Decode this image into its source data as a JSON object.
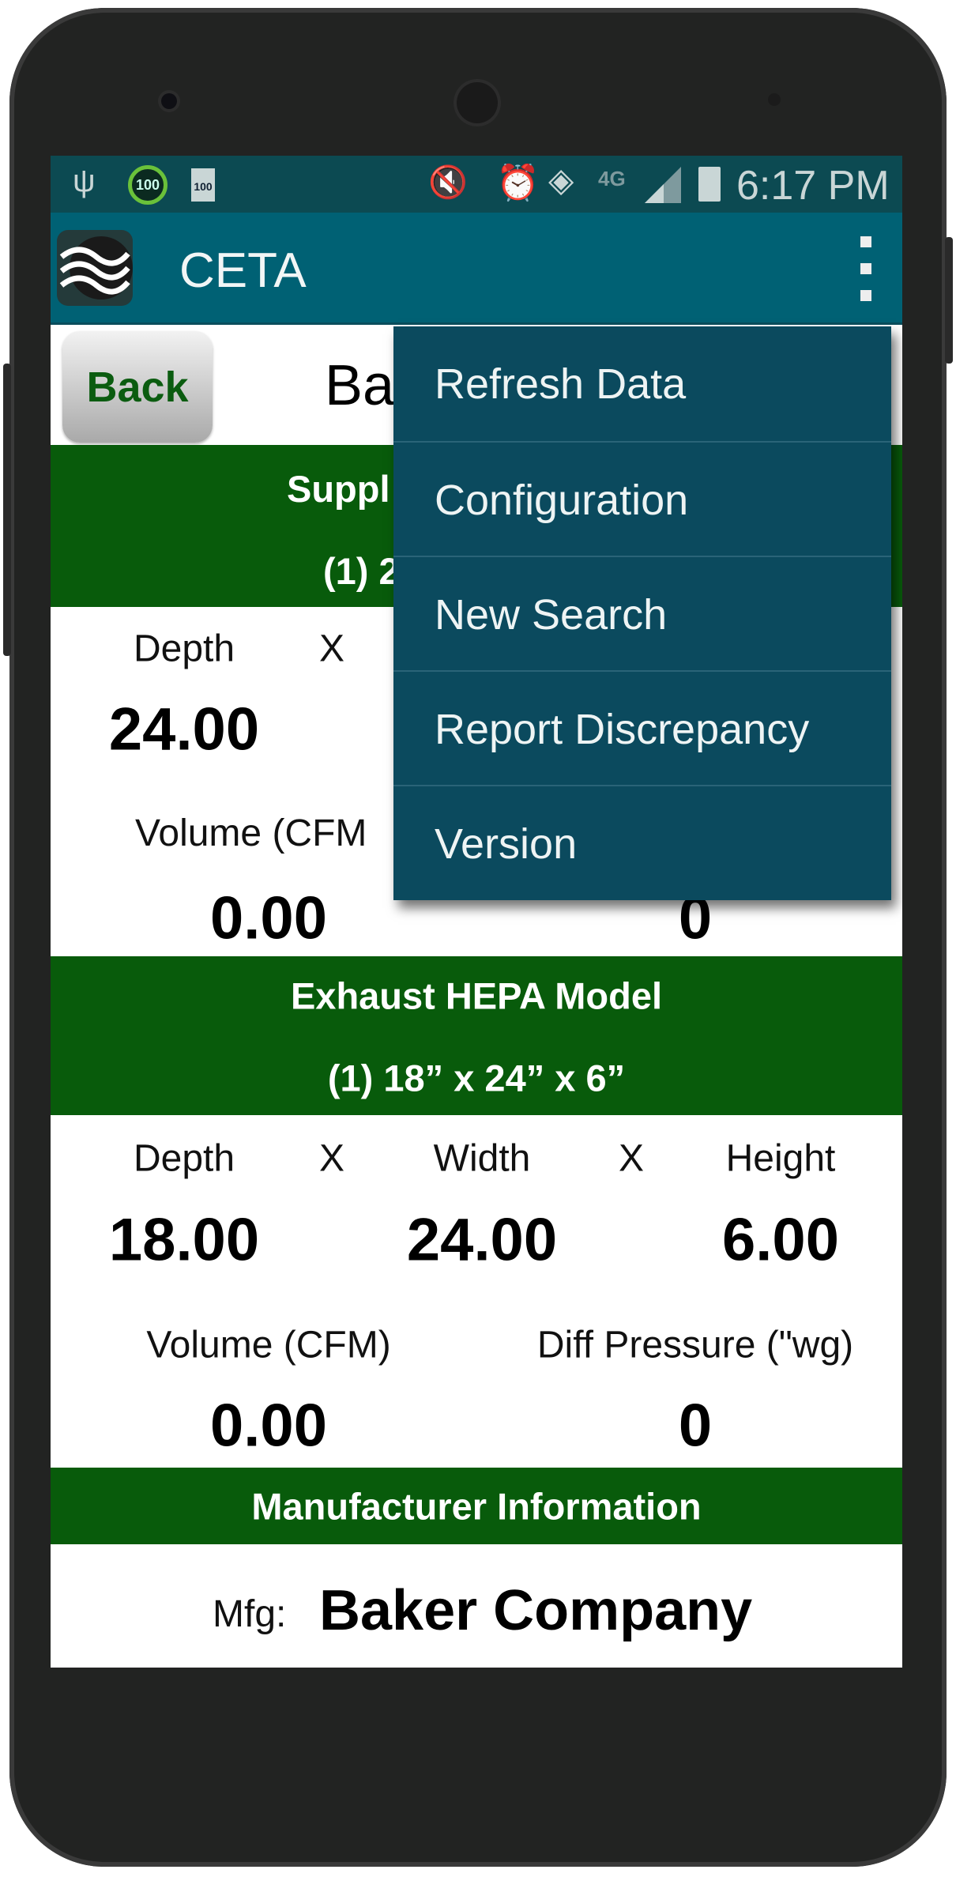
{
  "status_bar": {
    "time": "6:17 PM",
    "network": "4G",
    "battery_badge": "100",
    "circle_badge": "100",
    "icons": [
      "usb-icon",
      "battery-saver-icon",
      "battery-widget-icon",
      "mute-vibrate-icon",
      "alarm-icon",
      "wifi-icon",
      "network-4g-icon",
      "signal-icon",
      "battery-icon"
    ]
  },
  "app_bar": {
    "title": "CETA",
    "logo": "waves-logo",
    "overflow_icon": "more-vertical-icon"
  },
  "header": {
    "back_label": "Back",
    "title_visible": "Ba"
  },
  "overflow_menu": {
    "items": [
      {
        "label": "Refresh Data"
      },
      {
        "label": "Configuration"
      },
      {
        "label": "New Search"
      },
      {
        "label": "Report Discrepancy"
      },
      {
        "label": "Version"
      }
    ]
  },
  "supply": {
    "title_visible": "Suppl",
    "model_visible": "(1) 2",
    "depth_label": "Depth",
    "x_label": "X",
    "depth_value": "24.00",
    "volume_label_visible": "Volume (CFM",
    "volume_value": "0.00",
    "pressure_value": "0"
  },
  "exhaust": {
    "title": "Exhaust HEPA Model",
    "model": "(1) 18” x 24” x 6”",
    "depth_label": "Depth",
    "x_label": "X",
    "width_label": "Width",
    "height_label": "Height",
    "depth_value": "18.00",
    "width_value": "24.00",
    "height_value": "6.00",
    "volume_label": "Volume (CFM)",
    "pressure_label": "Diff Pressure (\"wg)",
    "volume_value": "0.00",
    "pressure_value": "0"
  },
  "manufacturer": {
    "title": "Manufacturer Information",
    "mfg_label": "Mfg:",
    "mfg_value": "Baker Company"
  },
  "colors": {
    "status_bar": "#0c4a52",
    "app_bar": "#006174",
    "menu": "#0b4a5e",
    "section_band": "#085b0b",
    "back_text": "#0b5c10"
  }
}
